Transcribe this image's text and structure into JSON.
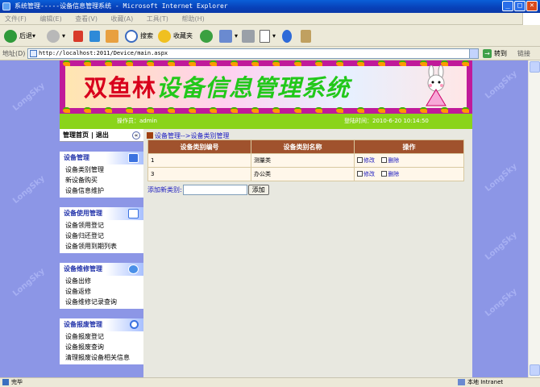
{
  "window": {
    "title": "系统管理-----设备信息管理系统 - Microsoft Internet Explorer"
  },
  "menu": [
    "文件(F)",
    "编辑(E)",
    "查看(V)",
    "收藏(A)",
    "工具(T)",
    "帮助(H)"
  ],
  "toolbar": {
    "back": "后退",
    "search": "搜索",
    "favorites": "收藏夹"
  },
  "address": {
    "label": "地址(D)",
    "url": "http://localhost:2011/Device/main.aspx",
    "go": "转到",
    "links": "链接"
  },
  "watermark": "LongSky",
  "banner": {
    "title_a": "双鱼林",
    "title_b": "设备信息管理系统"
  },
  "infobar": {
    "operator": "操作员：admin",
    "login_time": "登陆时间：2010-6-20 10:14:50"
  },
  "nav": {
    "home": "管理首页",
    "sep": "|",
    "logout": "退出",
    "collapse": "«"
  },
  "sections": [
    {
      "title": "设备管理",
      "items": [
        "设备类别管理",
        "新设备购买",
        "设备信息维护"
      ]
    },
    {
      "title": "设备使用管理",
      "items": [
        "设备领用登记",
        "设备归还登记",
        "设备领用到期列表"
      ]
    },
    {
      "title": "设备维修管理",
      "items": [
        "设备出修",
        "设备返修",
        "设备维修记录查询"
      ]
    },
    {
      "title": "设备报废管理",
      "items": [
        "设备报废登记",
        "设备报废查询",
        "清理报废设备相关信息"
      ]
    }
  ],
  "content": {
    "breadcrumb": "设备管理-->设备类别管理",
    "columns": [
      "设备类别编号",
      "设备类别名称",
      "操作"
    ],
    "rows": [
      {
        "id": "1",
        "name": "测量类"
      },
      {
        "id": "3",
        "name": "办公类"
      }
    ],
    "edit": "修改",
    "delete": "删除",
    "add_label": "添加新类别:",
    "add_value": "",
    "add_button": "添加"
  },
  "status": {
    "left": "完毕",
    "right": "本地 Intranet"
  }
}
